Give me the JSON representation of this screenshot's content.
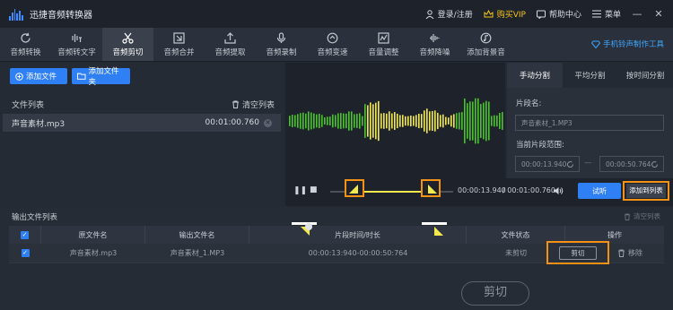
{
  "app": {
    "title": "迅捷音频转换器"
  },
  "titlebar": {
    "login": "登录/注册",
    "vip": "购买VIP",
    "help": "帮助中心",
    "menu": "菜单"
  },
  "toolbar": {
    "tools": [
      {
        "label": "音频转换",
        "icon": "refresh-icon"
      },
      {
        "label": "音频转文字",
        "icon": "speech-to-text-icon"
      },
      {
        "label": "音频剪切",
        "icon": "scissors-icon",
        "active": true
      },
      {
        "label": "音频合并",
        "icon": "merge-icon"
      },
      {
        "label": "音频提取",
        "icon": "extract-icon"
      },
      {
        "label": "音频录制",
        "icon": "microphone-icon"
      },
      {
        "label": "音频变速",
        "icon": "speed-icon"
      },
      {
        "label": "音量调整",
        "icon": "volume-adjust-icon"
      },
      {
        "label": "音频降噪",
        "icon": "noise-reduction-icon"
      },
      {
        "label": "添加背景音",
        "icon": "music-note-icon"
      }
    ],
    "mobile_link": "手机铃声制作工具"
  },
  "left_panel": {
    "add_file": "添加文件",
    "add_folder": "添加文件夹",
    "file_list_label": "文件列表",
    "clear_list": "清空列表",
    "files": [
      {
        "name": "声音素材.mp3",
        "duration": "00:01:00.760"
      }
    ]
  },
  "player": {
    "current_time": "00:00:13.940",
    "total_time": "/ 00:01:00.760",
    "try_listen": "试听",
    "add_to_list": "添加到列表"
  },
  "split_panel": {
    "tabs": [
      "手动分割",
      "平均分割",
      "按时间分割"
    ],
    "segment_name_label": "片段名:",
    "segment_name_value": "声音素材_1.MP3",
    "range_label": "当前片段范围:",
    "range_start": "00:00:13.940",
    "range_separator": "—",
    "range_end": "00:00:50.764"
  },
  "output": {
    "title": "输出文件列表",
    "clear": "清空列表",
    "columns": [
      "原文件名",
      "输出文件名",
      "片段时间/时长",
      "文件状态",
      "操作"
    ],
    "rows": [
      {
        "source": "声音素材.mp3",
        "output": "声音素材_1.MP3",
        "segment": "00:00:13:940-00:00:50:764",
        "status": "未剪切",
        "cut": "剪切",
        "remove": "移除"
      }
    ],
    "big_cut": "剪切"
  },
  "colors": {
    "accent": "#2f7ff5",
    "highlight": "#f39214",
    "wave_green": "#49c42d",
    "wave_yellow": "#f2e94e",
    "vip": "#f5c518"
  }
}
